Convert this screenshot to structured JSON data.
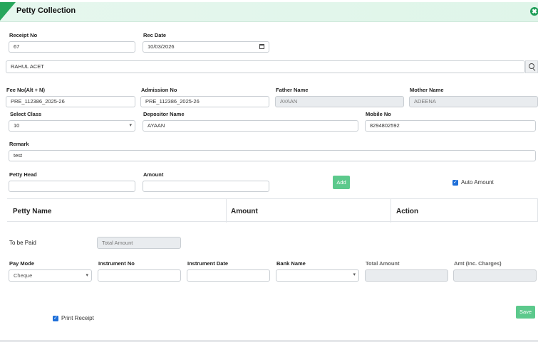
{
  "header": {
    "title": "Petty Collection",
    "close_glyph": "✖"
  },
  "receipt": {
    "label": "Receipt No",
    "value": "67"
  },
  "rec_date": {
    "label": "Rec Date",
    "value": "10/03/2026"
  },
  "student_search": {
    "value": "RAHUL ACET"
  },
  "fee_no": {
    "label": "Fee No(Alt + N)",
    "value": "PRE_112386_2025-26"
  },
  "admission_no": {
    "label": "Admission No",
    "value": "PRE_112386_2025-26"
  },
  "father_name": {
    "label": "Father Name",
    "value": "AYAAN"
  },
  "mother_name": {
    "label": "Mother Name",
    "value": "ADEENA"
  },
  "select_class": {
    "label": "Select Class",
    "value": "10"
  },
  "depositor_name": {
    "label": "Depositor Name",
    "value": "AYAAN"
  },
  "mobile_no": {
    "label": "Mobile No",
    "value": "8294802592"
  },
  "remark": {
    "label": "Remark",
    "value": "test"
  },
  "petty_head": {
    "label": "Petty Head",
    "value": ""
  },
  "amount": {
    "label": "Amount",
    "value": ""
  },
  "add_button": "Add",
  "auto_amount": {
    "label": "Auto Amount",
    "checked": true
  },
  "table": {
    "columns": [
      "Petty Name",
      "Amount",
      "Action"
    ]
  },
  "to_be_paid": {
    "label": "To be Paid",
    "placeholder": "Total Amount"
  },
  "pay_mode": {
    "label": "Pay Mode",
    "value": "Cheque"
  },
  "instrument_no": {
    "label": "Instrument No",
    "value": ""
  },
  "instrument_date": {
    "label": "Instrument Date",
    "value": ""
  },
  "bank_name": {
    "label": "Bank Name",
    "value": ""
  },
  "total_amount": {
    "label": "Total Amount",
    "value": ""
  },
  "amt_inc_charges": {
    "label": "Amt (Inc. Charges)",
    "value": ""
  },
  "print_receipt": {
    "label": "Print Receipt",
    "checked": true
  },
  "save_button": "Save",
  "colors": {
    "accent": "#26a65b",
    "button": "#5cc98c",
    "checkbox": "#1e6fd9"
  }
}
